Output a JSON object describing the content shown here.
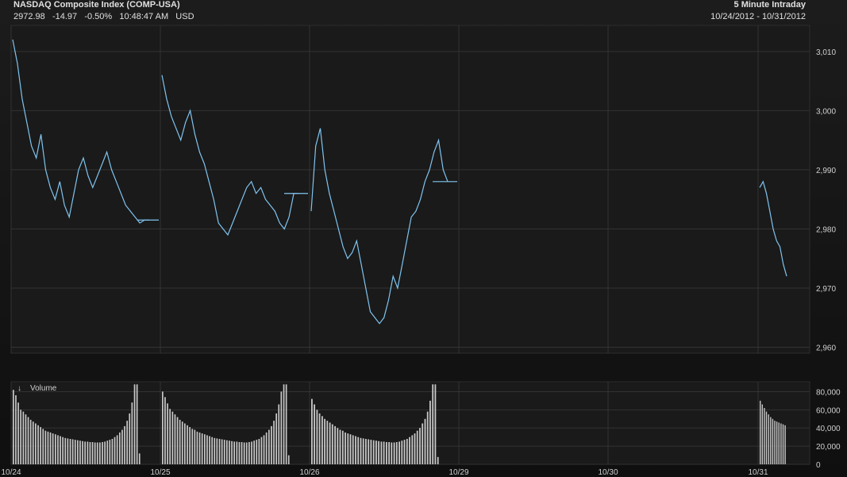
{
  "header": {
    "title": "NASDAQ Composite Index (COMP-USA)",
    "last": "2972.98",
    "change": "-14.97",
    "pct": "-0.50%",
    "time": "10:48:47 AM",
    "currency": "USD",
    "interval": "5 Minute Intraday",
    "range": "10/24/2012 - 10/31/2012"
  },
  "colors": {
    "line": "#7fc4f0",
    "volume": "#c8c8c8",
    "grid": "#333333",
    "background": "#111111"
  },
  "chart_data": [
    {
      "type": "line",
      "title": "NASDAQ Composite Index (COMP-USA)",
      "ylim": [
        2959,
        3014
      ],
      "y_ticks": [
        "3,010",
        "3,000",
        "2,990",
        "2,980",
        "2,970",
        "2,960"
      ],
      "x_ticks": [
        "10/24",
        "10/25",
        "10/26",
        "10/29",
        "10/30",
        "10/31"
      ],
      "series": [
        {
          "day": "10/24",
          "points": [
            3012,
            3008,
            3002,
            2998,
            2994,
            2992,
            2996,
            2990,
            2987,
            2985,
            2988,
            2984,
            2982,
            2986,
            2990,
            2992,
            2989,
            2987,
            2989,
            2991,
            2993,
            2990,
            2988,
            2986,
            2984,
            2983,
            2982,
            2981,
            2981.5,
            2981.5
          ]
        },
        {
          "day": "10/25",
          "points": [
            3006,
            3002,
            2999,
            2997,
            2995,
            2998,
            3000,
            2996,
            2993,
            2991,
            2988,
            2985,
            2981,
            2980,
            2979,
            2981,
            2983,
            2985,
            2987,
            2988,
            2986,
            2987,
            2985,
            2984,
            2983,
            2981,
            2980,
            2982,
            2986,
            2986
          ]
        },
        {
          "day": "10/26",
          "points": [
            2983,
            2994,
            2997,
            2990,
            2986,
            2983,
            2980,
            2977,
            2975,
            2976,
            2978,
            2974,
            2970,
            2966,
            2965,
            2964,
            2965,
            2968,
            2972,
            2970,
            2974,
            2978,
            2982,
            2983,
            2985,
            2988,
            2990,
            2993,
            2995,
            2990,
            2988
          ]
        },
        {
          "day": "10/29",
          "points": [
            2988,
            2988
          ]
        },
        {
          "day": "10/31",
          "points": [
            2987,
            2988,
            2986,
            2983,
            2980,
            2978,
            2977,
            2974,
            2972
          ]
        }
      ]
    },
    {
      "type": "bar",
      "title": "Volume",
      "ylim": [
        0,
        90000
      ],
      "y_ticks": [
        "80,000",
        "60,000",
        "40,000",
        "20,000",
        "0"
      ],
      "series": [
        {
          "day": "10/24",
          "values": [
            82000,
            76000,
            68000,
            60000,
            58000,
            55000,
            52000,
            49000,
            47000,
            45000,
            43000,
            41000,
            39000,
            37000,
            36000,
            35000,
            34000,
            33000,
            32000,
            31000,
            30000,
            29000,
            28500,
            28000,
            27500,
            27000,
            26500,
            26000,
            25500,
            25000,
            25000,
            24500,
            24500,
            24000,
            24000,
            24000,
            24500,
            25000,
            26000,
            27000,
            28000,
            30000,
            32000,
            35000,
            38000,
            42000,
            48000,
            56000,
            68000,
            88000,
            88000,
            12000
          ]
        },
        {
          "day": "10/25",
          "values": [
            80000,
            74000,
            67000,
            61000,
            58000,
            55000,
            52000,
            49000,
            47000,
            45000,
            43000,
            41000,
            39000,
            38000,
            36000,
            35000,
            34000,
            33000,
            32000,
            31000,
            30000,
            29000,
            28500,
            28000,
            27500,
            27000,
            26500,
            26000,
            25500,
            25000,
            25000,
            24500,
            24500,
            24000,
            24000,
            24500,
            25000,
            26000,
            27000,
            28000,
            30000,
            32000,
            35000,
            38000,
            42000,
            48000,
            56000,
            66000,
            80000,
            88000,
            88000,
            10000
          ]
        },
        {
          "day": "10/26",
          "values": [
            72000,
            66000,
            60000,
            56000,
            53000,
            50000,
            48000,
            46000,
            44000,
            42000,
            40000,
            38000,
            37000,
            35000,
            34000,
            33000,
            32000,
            31000,
            30000,
            29000,
            28500,
            28000,
            27500,
            27000,
            26500,
            26000,
            25500,
            25000,
            25000,
            24500,
            24500,
            24000,
            24000,
            24500,
            25000,
            26000,
            27000,
            28000,
            30000,
            32000,
            34000,
            37000,
            40000,
            45000,
            50000,
            58000,
            70000,
            88000,
            88000,
            8000
          ]
        },
        {
          "day": "10/31",
          "values": [
            70000,
            66000,
            62000,
            58000,
            55000,
            52000,
            50000,
            48000,
            47000,
            46000,
            45000,
            44000,
            43000
          ]
        }
      ]
    }
  ]
}
